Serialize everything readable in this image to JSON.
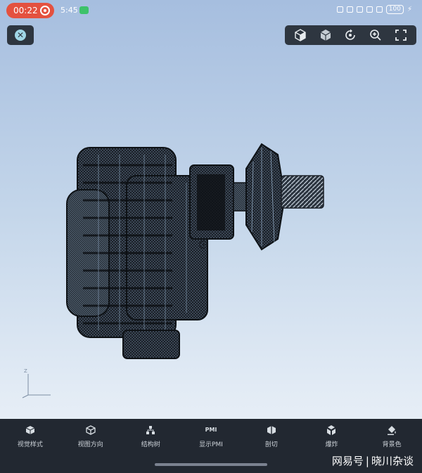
{
  "status_bar": {
    "recording_time": "00:22",
    "clock": "5:45",
    "battery": "100"
  },
  "bottom_toolbar": {
    "items": [
      {
        "label": "视觉样式",
        "icon": "cube-icon"
      },
      {
        "label": "视图方向",
        "icon": "cube-view-icon"
      },
      {
        "label": "结构树",
        "icon": "tree-icon"
      },
      {
        "label": "显示PMI",
        "icon": "pmi-icon"
      },
      {
        "label": "剖切",
        "icon": "section-cut-icon"
      },
      {
        "label": "爆炸",
        "icon": "explode-icon"
      },
      {
        "label": "背景色",
        "icon": "paint-bucket-icon"
      }
    ],
    "pmi_icon_text": "PMI"
  },
  "watermark": {
    "source": "网易号",
    "author": "晓川杂谈"
  },
  "axis": {
    "label": "Z"
  },
  "colors": {
    "toolbar_bg": "#2e3640",
    "bottom_bar_bg": "#222831",
    "record_red": "#e4513f",
    "close_accent": "#9fd6e6"
  }
}
